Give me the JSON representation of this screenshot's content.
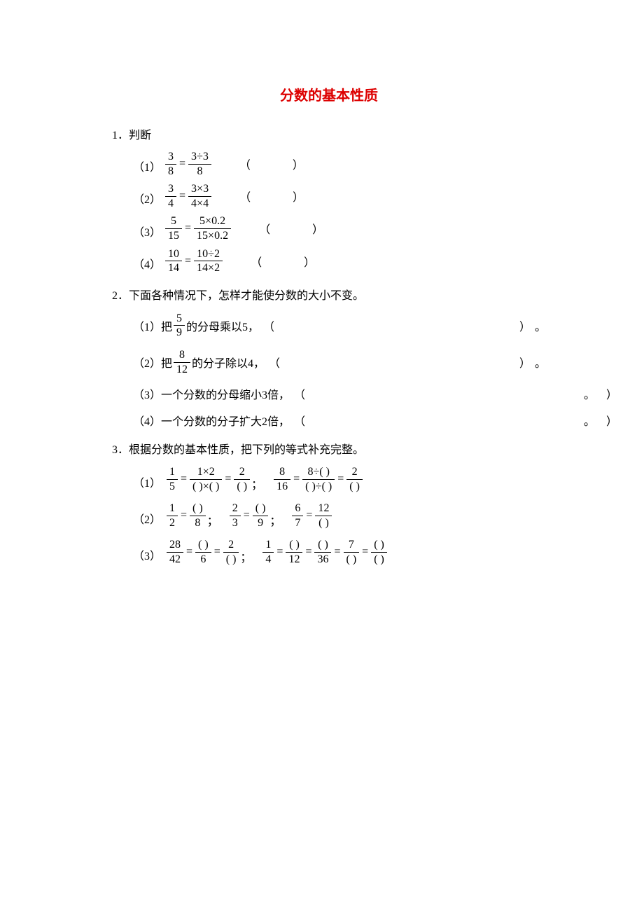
{
  "title": "分数的基本性质",
  "q1": {
    "head": "1．判断",
    "items": [
      {
        "label": "（1）",
        "left_num": "3",
        "left_den": "8",
        "right_num": "3÷3",
        "right_den": "8"
      },
      {
        "label": "（2）",
        "left_num": "3",
        "left_den": "4",
        "right_num": "3×3",
        "right_den": "4×4"
      },
      {
        "label": "（3）",
        "left_num": "5",
        "left_den": "15",
        "right_num": "5×0.2",
        "right_den": "15×0.2"
      },
      {
        "label": "（4）",
        "left_num": "10",
        "left_den": "14",
        "right_num": "10÷2",
        "right_den": "14×2"
      }
    ],
    "open": "（",
    "close": "）"
  },
  "q2": {
    "head": "2．下面各种情况下，怎样才能使分数的大小不变。",
    "items": [
      {
        "label": "（1）把",
        "frac_num": "5",
        "frac_den": "9",
        "tail": "的分母乘以5，"
      },
      {
        "label": "（2）把",
        "frac_num": "8",
        "frac_den": "12",
        "tail": "的分子除以4，"
      },
      {
        "label_full": "（3）一个分数的分母缩小3倍，"
      },
      {
        "label_full": "（4）一个分数的分子扩大2倍，"
      }
    ],
    "open": "（",
    "close": "）",
    "period": "。"
  },
  "q3": {
    "head": "3．根据分数的基本性质，把下列的等式补充完整。",
    "r1": {
      "label": "（1）",
      "a": {
        "n1": "1",
        "d1": "5",
        "n2": "1×2",
        "d2": "(  )×(  )",
        "n3": "2",
        "d3": "(  )"
      },
      "b": {
        "n1": "8",
        "d1": "16",
        "n2": "8÷(  )",
        "d2": "(  )÷(  )",
        "n3": "2",
        "d3": "(  )"
      }
    },
    "r2": {
      "label": "（2）",
      "a": {
        "n1": "1",
        "d1": "2",
        "n2": "(  )",
        "d2": "8"
      },
      "b": {
        "n1": "2",
        "d1": "3",
        "n2": "(  )",
        "d2": "9"
      },
      "c": {
        "n1": "6",
        "d1": "7",
        "n2": "12",
        "d2": "(  )"
      }
    },
    "r3": {
      "label": "（3）",
      "a": {
        "n1": "28",
        "d1": "42",
        "n2": "(  )",
        "d2": "6",
        "n3": "2",
        "d3": "(  )"
      },
      "b": {
        "n1": "1",
        "d1": "4",
        "n2": "(  )",
        "d2": "12",
        "n3": "(  )",
        "d3": "36",
        "n4": "7",
        "d4": "(  )",
        "n5": "(  )",
        "d5": "(  )"
      }
    },
    "semi": "；"
  }
}
